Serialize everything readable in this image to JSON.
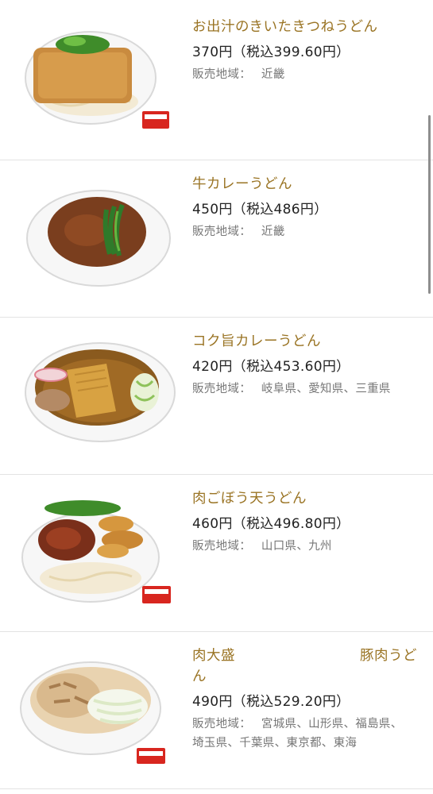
{
  "items": [
    {
      "title": "お出汁のきいたきつねうどん",
      "price": "370円（税込399.60円）",
      "region_label": "販売地域：",
      "region": "近畿",
      "image": "kitsune-udon-bowl-icon"
    },
    {
      "title": "牛カレーうどん",
      "price": "450円（税込486円）",
      "region_label": "販売地域：",
      "region": "近畿",
      "image": "beef-curry-udon-bowl-icon"
    },
    {
      "title": "コク旨カレーうどん",
      "price": "420円（税込453.60円）",
      "region_label": "販売地域：",
      "region": "岐阜県、愛知県、三重県",
      "image": "curry-udon-bowl-icon"
    },
    {
      "title": "肉ごぼう天うどん",
      "price": "460円（税込496.80円）",
      "region_label": "販売地域：",
      "region": "山口県、九州",
      "image": "niku-gobouten-udon-bowl-icon"
    },
    {
      "title_left": "肉大盛",
      "title_right": "豚肉うど",
      "title_line2": "ん",
      "price": "490円（税込529.20円）",
      "region_label": "販売地域：",
      "region_line1": "宮城県、山形県、福島県、",
      "region_line2": "埼玉県、千葉県、東京都、東海",
      "image": "butaniku-udon-bowl-icon"
    }
  ],
  "colors": {
    "title": "#9a7424",
    "price": "#222222",
    "region": "#777777",
    "divider": "#e3e3e3"
  }
}
